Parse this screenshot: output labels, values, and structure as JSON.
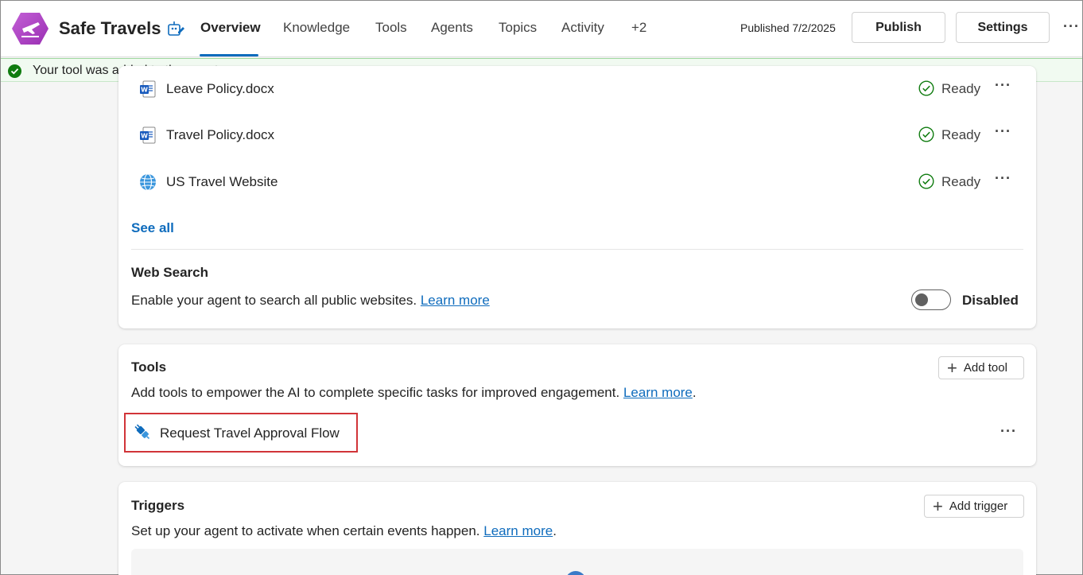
{
  "header": {
    "app_name": "Safe Travels",
    "tabs": [
      "Overview",
      "Knowledge",
      "Tools",
      "Agents",
      "Topics",
      "Activity",
      "+2"
    ],
    "published": "Published 7/2/2025",
    "publish_label": "Publish",
    "settings_label": "Settings",
    "more": "···"
  },
  "banner": {
    "message": "Your tool was added to the agent",
    "color": "#107c10"
  },
  "knowledge": {
    "items": [
      {
        "name": "Leave Policy.docx",
        "icon": "word-icon",
        "status": "Ready"
      },
      {
        "name": "Travel Policy.docx",
        "icon": "word-icon",
        "status": "Ready"
      },
      {
        "name": "US Travel Website",
        "icon": "globe-icon",
        "status": "Ready"
      }
    ],
    "see_all": "See all",
    "web_search": {
      "title": "Web Search",
      "description": "Enable your agent to search all public websites.",
      "learn_more": "Learn more",
      "toggle_state": "Disabled"
    }
  },
  "tools": {
    "title": "Tools",
    "add_label": "Add tool",
    "description": "Add tools to empower the AI to complete specific tasks for improved engagement.",
    "learn_more": "Learn more",
    "items": [
      {
        "name": "Request Travel Approval Flow",
        "icon": "plug-icon"
      }
    ]
  },
  "triggers": {
    "title": "Triggers",
    "add_label": "Add trigger",
    "description": "Set up your agent to activate when certain events happen.",
    "learn_more": "Learn more"
  },
  "colors": {
    "accent": "#0f6cbd",
    "success": "#107c10",
    "highlight": "#d13438",
    "brand": "#b146c2"
  }
}
